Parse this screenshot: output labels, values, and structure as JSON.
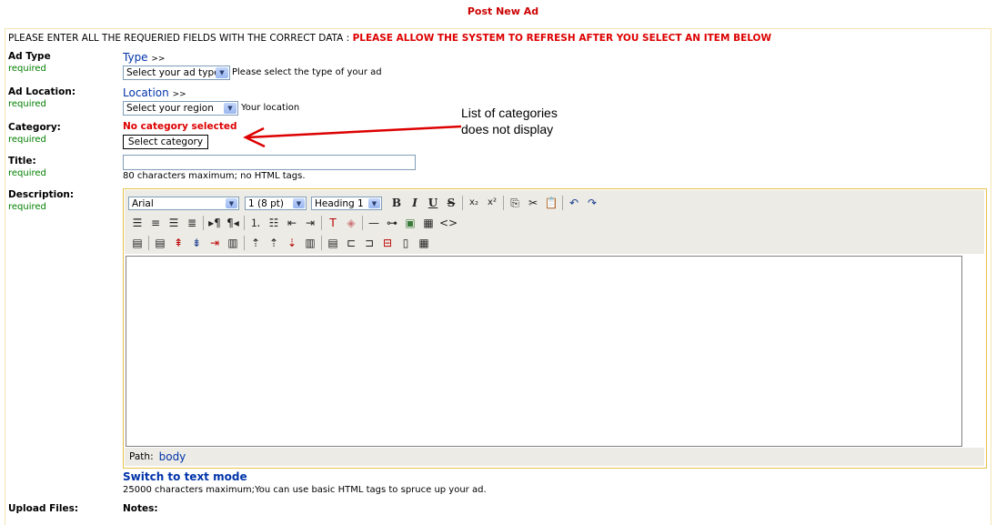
{
  "page": {
    "title": "Post New Ad"
  },
  "instructions": {
    "text": "PLEASE ENTER ALL THE REQUERIED FIELDS WITH THE CORRECT DATA : ",
    "warning": "PLEASE ALLOW THE SYSTEM TO REFRESH AFTER YOU SELECT AN ITEM BELOW"
  },
  "required_text": "required",
  "ad_type": {
    "label": "Ad Type",
    "link": "Type",
    "link_suffix": ">>",
    "select_value": "Select your ad type",
    "hint": "Please select the type of your ad"
  },
  "ad_location": {
    "label": "Ad Location:",
    "link": "Location",
    "link_suffix": ">>",
    "select_value": "Select your region",
    "hint": "Your location"
  },
  "category": {
    "label": "Category:",
    "status": "No category selected",
    "button": "Select category"
  },
  "annotation": {
    "line1": "List of categories",
    "line2": "does not display",
    "color": "#dd0000"
  },
  "title_field": {
    "label": "Title:",
    "value": "",
    "hint": "80 characters maximum; no HTML tags."
  },
  "description": {
    "label": "Description:",
    "font": "Arial",
    "size": "1 (8 pt)",
    "format": "Heading 1",
    "path_label": "Path:",
    "path_value": "body",
    "switch_link": "Switch to text mode",
    "hint": "25000 characters maximum;You can use basic HTML tags to spruce up your ad."
  },
  "upload": {
    "label": "Upload Files:",
    "notes_label": "Notes:"
  },
  "colors": {
    "accent_red": "#dd0000",
    "required_green": "#008000",
    "link_blue": "#0033aa",
    "editor_border": "#e5c24a"
  },
  "toolbar_icons": {
    "row1": [
      "bold-icon",
      "italic-icon",
      "underline-icon",
      "strikethrough-icon",
      "subscript-icon",
      "superscript-icon",
      "copy-icon",
      "cut-icon",
      "paste-icon",
      "undo-icon",
      "redo-icon"
    ],
    "row2": [
      "align-left-icon",
      "align-center-icon",
      "align-right-icon",
      "justify-icon",
      "ltr-icon",
      "rtl-icon",
      "ordered-list-icon",
      "unordered-list-icon",
      "outdent-icon",
      "indent-icon",
      "text-color-icon",
      "highlight-icon",
      "horizontal-rule-icon",
      "link-icon",
      "image-icon",
      "table-icon",
      "html-source-icon"
    ],
    "row3": [
      "table-properties-icon",
      "row-properties-icon",
      "insert-row-before-icon",
      "insert-row-after-icon",
      "delete-row-icon",
      "merge-rows-icon",
      "insert-col-before-icon",
      "insert-col-after-icon",
      "delete-col-icon",
      "merge-cols-icon",
      "cell-properties-icon",
      "insert-cell-before-icon",
      "insert-cell-after-icon",
      "delete-cell-icon",
      "split-cell-icon",
      "merge-cells-icon"
    ]
  }
}
